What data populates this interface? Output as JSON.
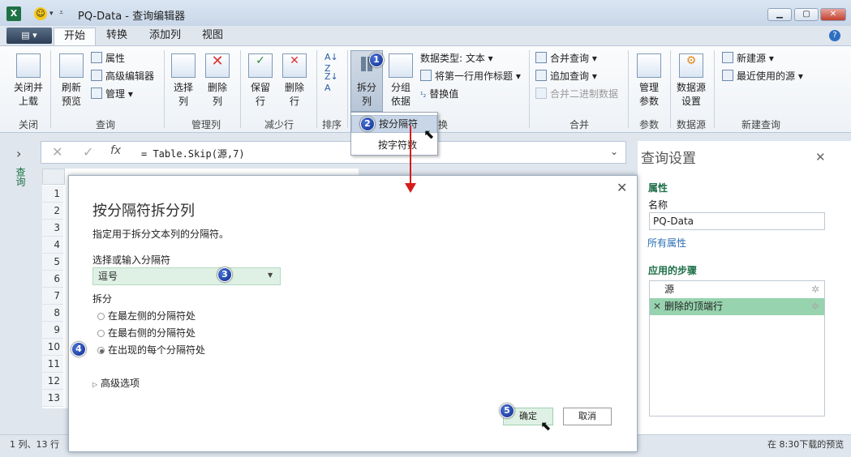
{
  "window": {
    "title": "PQ-Data - 查询编辑器",
    "app_icon": "X"
  },
  "tabs": {
    "file": "▤ ▾",
    "items": [
      "开始",
      "转换",
      "添加列",
      "视图"
    ]
  },
  "ribbon": {
    "close_load": "关闭并\n上载",
    "close_load_caret": "▾",
    "refresh_preview": "刷新\n预览",
    "properties": "属性",
    "advanced_editor": "高级编辑器",
    "manage": "管理",
    "choose_columns": "选择\n列",
    "remove_columns": "删除\n列",
    "keep_rows": "保留\n行",
    "remove_rows": "删除\n行",
    "split_column": "拆分\n列",
    "group_by": "分组\n依据",
    "data_type": "数据类型: 文本",
    "first_row_header": "将第一行用作标题",
    "replace_values": "替换值",
    "merge_queries": "合并查询",
    "append_queries": "追加查询",
    "combine_binaries": "合并二进制数据",
    "manage_params": "管理\n参数",
    "data_source_settings": "数据源\n设置",
    "new_source": "新建源",
    "recent_sources": "最近使用的源",
    "groups": {
      "close": "关闭",
      "query": "查询",
      "manage_cols": "管理列",
      "reduce_rows": "减少行",
      "sort": "排序",
      "transform": "换",
      "combine": "合并",
      "params": "参数",
      "data_source": "数据源",
      "new_query": "新建查询"
    }
  },
  "dropdown": {
    "by_delimiter": "按分隔符",
    "by_chars": "按字符数"
  },
  "nav": {
    "queries_label": "查询"
  },
  "formula": {
    "text": "= Table.Skip(源,7)",
    "fx": "fx"
  },
  "grid": {
    "rows": [
      "1",
      "2",
      "3",
      "4",
      "5",
      "6",
      "7",
      "8",
      "9",
      "10",
      "11",
      "12",
      "13"
    ]
  },
  "status": {
    "left": "1 列、13 行",
    "right": "在 8:30下载的预览"
  },
  "settings": {
    "title": "查询设置",
    "props_heading": "属性",
    "name_label": "名称",
    "name_value": "PQ-Data",
    "all_props": "所有属性",
    "steps_heading": "应用的步骤",
    "steps": [
      "源",
      "删除的顶端行"
    ]
  },
  "dialog": {
    "title": "按分隔符拆分列",
    "description": "指定用于拆分文本列的分隔符。",
    "select_label": "选择或输入分隔符",
    "select_value": "逗号",
    "split_label": "拆分",
    "options": [
      "在最左侧的分隔符处",
      "在最右侧的分隔符处",
      "在出现的每个分隔符处"
    ],
    "selected_option": 2,
    "advanced": "高级选项",
    "ok": "确定",
    "cancel": "取消"
  },
  "badges": [
    "1",
    "2",
    "3",
    "4",
    "5"
  ],
  "colors": {
    "accent_green": "#1e7145",
    "selection_green": "#dff1e5",
    "annotation_red": "#d61b1b",
    "badge_blue": "#0c2c8f"
  }
}
